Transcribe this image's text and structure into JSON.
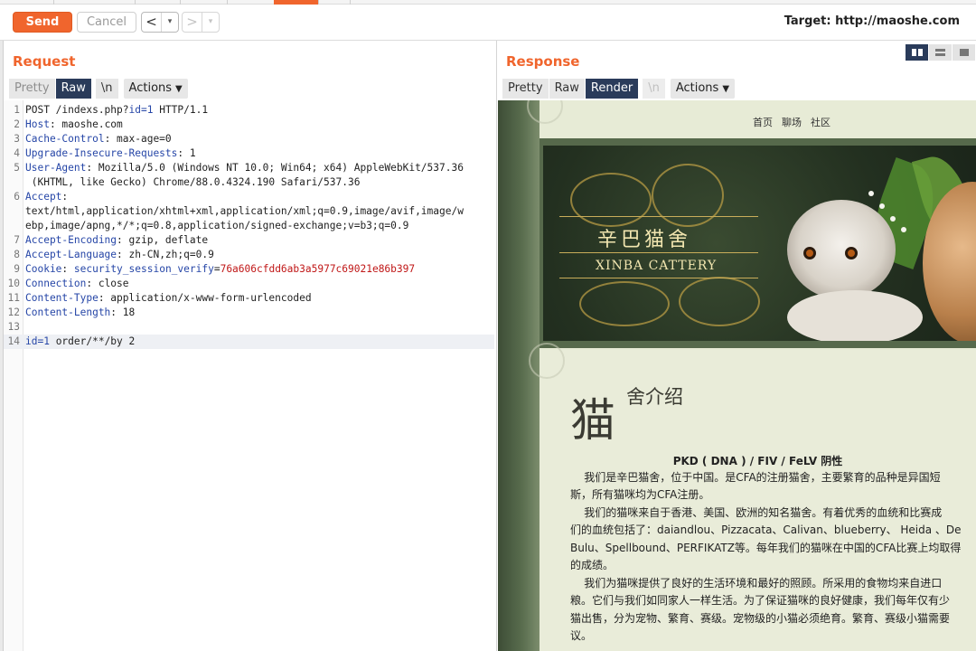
{
  "toolbar": {
    "send_label": "Send",
    "cancel_label": "Cancel",
    "back_arrow": "<",
    "forward_arrow": ">",
    "dropdown_glyph": "▾",
    "target_label": "Target: http://maoshe.com"
  },
  "request": {
    "title": "Request",
    "tabs": {
      "pretty": "Pretty",
      "raw": "Raw",
      "newline": "\\n",
      "actions": "Actions"
    },
    "lines": [
      {
        "n": "1",
        "parts": [
          [
            "v",
            "POST /indexs.php?"
          ],
          [
            "q",
            "id=1"
          ],
          [
            "v",
            " HTTP/1.1"
          ]
        ]
      },
      {
        "n": "2",
        "parts": [
          [
            "k",
            "Host"
          ],
          [
            "v",
            ": maoshe.com"
          ]
        ]
      },
      {
        "n": "3",
        "parts": [
          [
            "k",
            "Cache-Control"
          ],
          [
            "v",
            ": max-age=0"
          ]
        ]
      },
      {
        "n": "4",
        "parts": [
          [
            "k",
            "Upgrade-Insecure-Requests"
          ],
          [
            "v",
            ": 1"
          ]
        ]
      },
      {
        "n": "5",
        "parts": [
          [
            "k",
            "User-Agent"
          ],
          [
            "v",
            ": Mozilla/5.0 (Windows NT 10.0; Win64; x64) AppleWebKit/537.36"
          ]
        ]
      },
      {
        "n": "",
        "parts": [
          [
            "v",
            " (KHTML, like Gecko) Chrome/88.0.4324.190 Safari/537.36"
          ]
        ]
      },
      {
        "n": "6",
        "parts": [
          [
            "k",
            "Accept"
          ],
          [
            "v",
            ":"
          ]
        ]
      },
      {
        "n": "",
        "parts": [
          [
            "v",
            "text/html,application/xhtml+xml,application/xml;q=0.9,image/avif,image/w"
          ]
        ]
      },
      {
        "n": "",
        "parts": [
          [
            "v",
            "ebp,image/apng,*/*;q=0.8,application/signed-exchange;v=b3;q=0.9"
          ]
        ]
      },
      {
        "n": "7",
        "parts": [
          [
            "k",
            "Accept-Encoding"
          ],
          [
            "v",
            ": gzip, deflate"
          ]
        ]
      },
      {
        "n": "8",
        "parts": [
          [
            "k",
            "Accept-Language"
          ],
          [
            "v",
            ": zh-CN,zh;q=0.9"
          ]
        ]
      },
      {
        "n": "9",
        "parts": [
          [
            "k",
            "Cookie"
          ],
          [
            "v",
            ": "
          ],
          [
            "ck",
            "security_session_verify"
          ],
          [
            "v",
            "="
          ],
          [
            "cv",
            "76a606cfdd6ab3a5977c69021e86b397"
          ]
        ]
      },
      {
        "n": "10",
        "parts": [
          [
            "k",
            "Connection"
          ],
          [
            "v",
            ": close"
          ]
        ]
      },
      {
        "n": "11",
        "parts": [
          [
            "k",
            "Content-Type"
          ],
          [
            "v",
            ": application/x-www-form-urlencoded"
          ]
        ]
      },
      {
        "n": "12",
        "parts": [
          [
            "k",
            "Content-Length"
          ],
          [
            "v",
            ": 18"
          ]
        ]
      },
      {
        "n": "13",
        "parts": []
      },
      {
        "n": "14",
        "parts": [
          [
            "q",
            "id=1"
          ],
          [
            "v",
            " order/**/by 2"
          ]
        ],
        "current": true
      }
    ]
  },
  "response": {
    "title": "Response",
    "tabs": {
      "pretty": "Pretty",
      "raw": "Raw",
      "render": "Render",
      "newline": "\\n",
      "actions": "Actions"
    },
    "page": {
      "nav": [
        "首页",
        "聊场",
        "社区"
      ],
      "logo_cn": "辛巴猫舍",
      "logo_en": "XINBA CATTERY",
      "big_char": "猫",
      "subheading": "舍介绍",
      "pkd_title": "PKD ( DNA ) / FIV / FeLV 阴性",
      "paragraphs": [
        "    我们是辛巴猫舍，位于中国。是CFA的注册猫舍，主要繁育的品种是异国短",
        "斯，所有猫咪均为CFA注册。",
        "    我们的猫咪来自于香港、美国、欧洲的知名猫舍。有着优秀的血统和比赛成",
        "们的血统包括了：daiandlou、Pizzacata、Calivan、blueberry、 Heida 、De",
        "Bulu、Spellbound、PERFIKATZ等。每年我们的猫咪在中国的CFA比赛上均取得",
        "的成绩。",
        "    我们为猫咪提供了良好的生活环境和最好的照顾。所采用的食物均来自进口",
        "粮。它们与我们如同家人一样生活。为了保证猫咪的良好健康，我们每年仅有少",
        "猫出售，分为宠物、繁育、赛级。宠物级的小猫必须绝育。繁育、赛级小猫需要",
        "议。"
      ]
    }
  },
  "colors": {
    "accent": "#f0652d",
    "selected_tab": "#2a3b5a",
    "header_key": "#2646a7",
    "cookie_value": "#c01717"
  }
}
